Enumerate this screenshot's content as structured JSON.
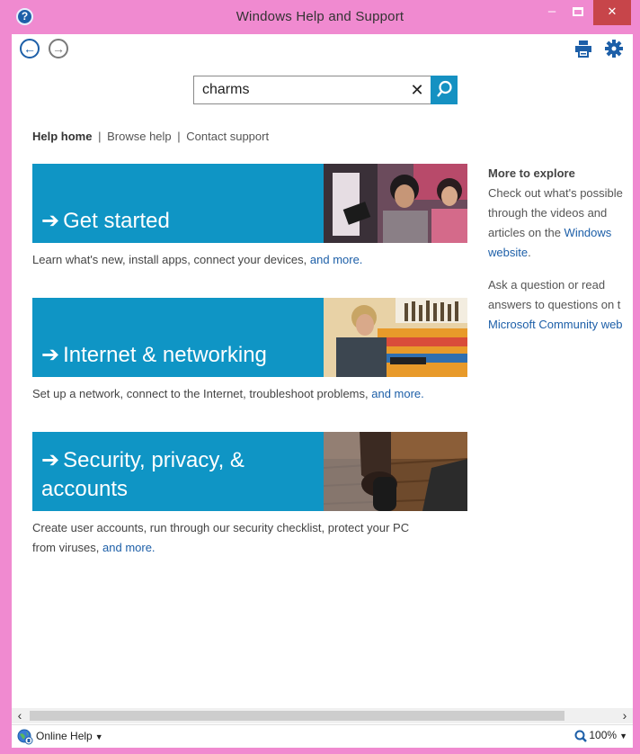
{
  "window": {
    "title": "Windows Help and Support",
    "help_glyph": "?",
    "minimize_glyph": "–",
    "close_glyph": "✕"
  },
  "toolbar": {
    "back_icon": "back-arrow-icon",
    "forward_icon": "forward-arrow-icon",
    "print_icon": "print-icon",
    "settings_icon": "gear-icon"
  },
  "search": {
    "value": "charms",
    "clear_glyph": "✕"
  },
  "links": {
    "home": "Help home",
    "sep1": "|",
    "browse": "Browse help",
    "sep2": "|",
    "contact": "Contact support"
  },
  "tiles": [
    {
      "arrow": "➔",
      "label": "Get started",
      "desc": "Learn what's new, install apps, connect your devices, ",
      "more": "and more."
    },
    {
      "arrow": "➔",
      "label": "Internet & networking",
      "desc": "Set up a network, connect to the Internet, troubleshoot problems, ",
      "more": "and more."
    },
    {
      "arrow": "➔",
      "label_line1": "Security, privacy, &",
      "label_line2": "accounts",
      "desc_line1": "Create user accounts, run through our security checklist, protect your PC",
      "desc_line2": "from viruses, ",
      "more": "and more."
    }
  ],
  "sidebar": {
    "heading": "More to explore",
    "p1_line1": "Check out what's possible",
    "p1_line2": "through the videos and",
    "p1_line3": "articles on the ",
    "p1_link1": "Windows",
    "p1_link2": "website",
    "p1_end": ".",
    "p2_line1": "Ask a question or read",
    "p2_line2": "answers to questions on t",
    "p2_link": "Microsoft Community web"
  },
  "scrollbar": {
    "left_glyph": "‹",
    "right_glyph": "›"
  },
  "status": {
    "online_help": "Online Help",
    "dropdown_glyph": "▼",
    "zoom": "100%"
  },
  "colors": {
    "window_frame": "#f08ad0",
    "tile_blue": "#0f95c5",
    "link": "#1d5fa8",
    "close_red": "#c7454a"
  }
}
